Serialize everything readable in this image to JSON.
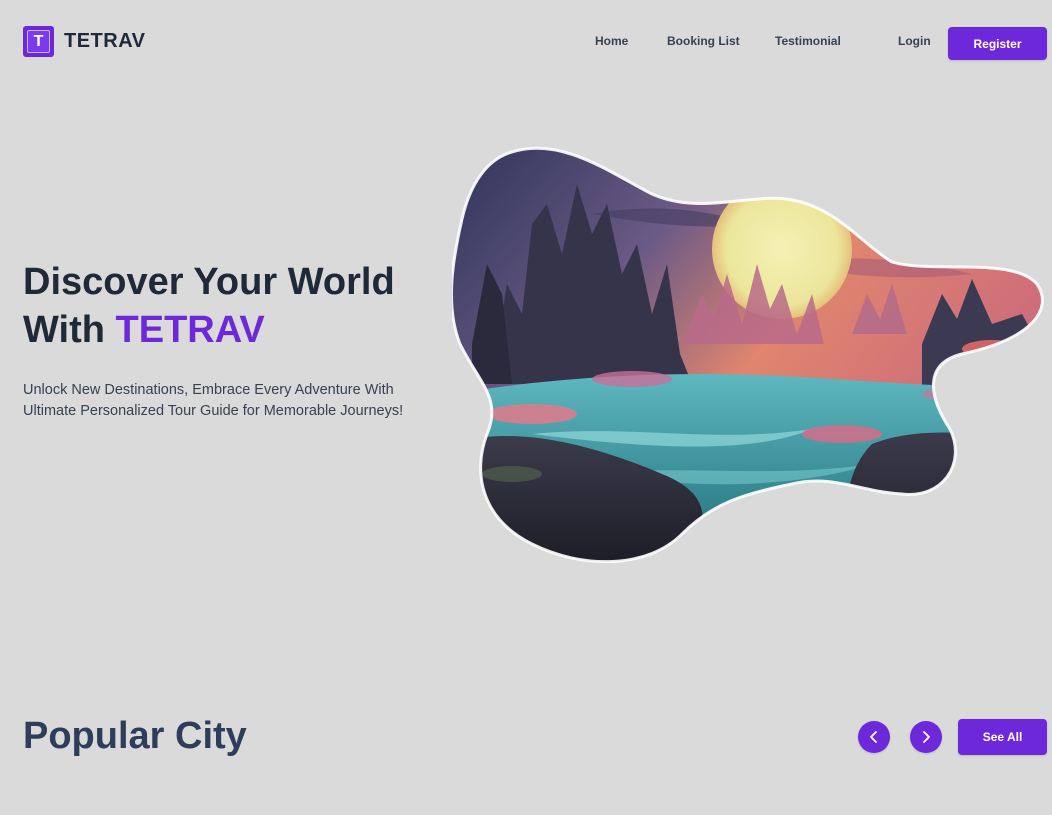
{
  "brand": {
    "logo_letter": "T",
    "name": "TETRAV"
  },
  "nav": {
    "items": [
      {
        "label": "Home"
      },
      {
        "label": "Booking List"
      },
      {
        "label": "Testimonial"
      }
    ],
    "login_label": "Login",
    "register_label": "Register"
  },
  "hero": {
    "title_line1": "Discover Your World",
    "title_line2_prefix": "With ",
    "title_accent": "TETRAV",
    "subtitle": "Unlock New Destinations, Embrace Every Adventure With Ultimate Personalized Tour Guide for Memorable Journeys!",
    "image_icon": "fantasy-landscape-illustration"
  },
  "popular_city": {
    "title": "Popular City",
    "prev_icon": "chevron-left-icon",
    "next_icon": "chevron-right-icon",
    "see_all_label": "See All"
  },
  "colors": {
    "accent": "#6d28d9",
    "background": "#dadada",
    "heading": "#1f2937",
    "section_heading": "#2d3d5a"
  }
}
